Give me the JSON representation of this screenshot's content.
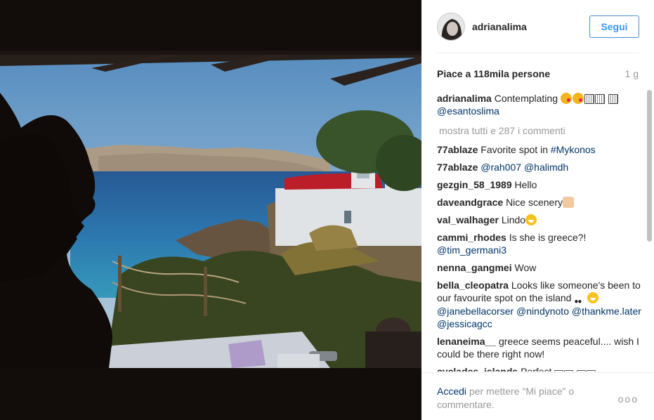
{
  "profile": {
    "username": "adrianalima",
    "follow_label": "Segui"
  },
  "post": {
    "likes": "Piace a 118mila persone",
    "age": "1 g",
    "caption_user": "adrianalima",
    "caption_text": "Contemplating",
    "caption_mention": "@esantoslima",
    "show_all": "mostra tutti e 287 i commenti"
  },
  "comments": [
    {
      "user": "77ablaze",
      "text": "Favorite spot in",
      "mention": "#Mykonos"
    },
    {
      "user": "77ablaze",
      "text": "",
      "mention": "@rah007 @halimdh"
    },
    {
      "user": "gezgin_58_1989",
      "text": "Hello",
      "mention": ""
    },
    {
      "user": "daveandgrace",
      "text": "Nice scenery",
      "mention": ""
    },
    {
      "user": "val_walhager",
      "text": "Lindo",
      "mention": ""
    },
    {
      "user": "cammi_rhodes",
      "text": "Is she is greece?!",
      "mention": "@tim_germani3"
    },
    {
      "user": "nenna_gangmei",
      "text": "Wow",
      "mention": ""
    },
    {
      "user": "bella_cleopatra",
      "text": "Looks like someone's been to our favourite spot on the island",
      "mention": "@janebellacorser @nindynoto @thankme.later @jessicagcc"
    },
    {
      "user": "lenaneima__",
      "text": "greece seems peaceful.... wish I could be there right now!",
      "mention": ""
    },
    {
      "user": "cyclades_islands",
      "text": "Perfect",
      "mention": ""
    }
  ],
  "footer": {
    "login_label": "Accedi",
    "message": "per mettere \"Mi piace\" o commentare.",
    "more_label": "ooo"
  },
  "colors": {
    "accent": "#3897f0",
    "mention": "#003569",
    "muted": "#999999"
  }
}
